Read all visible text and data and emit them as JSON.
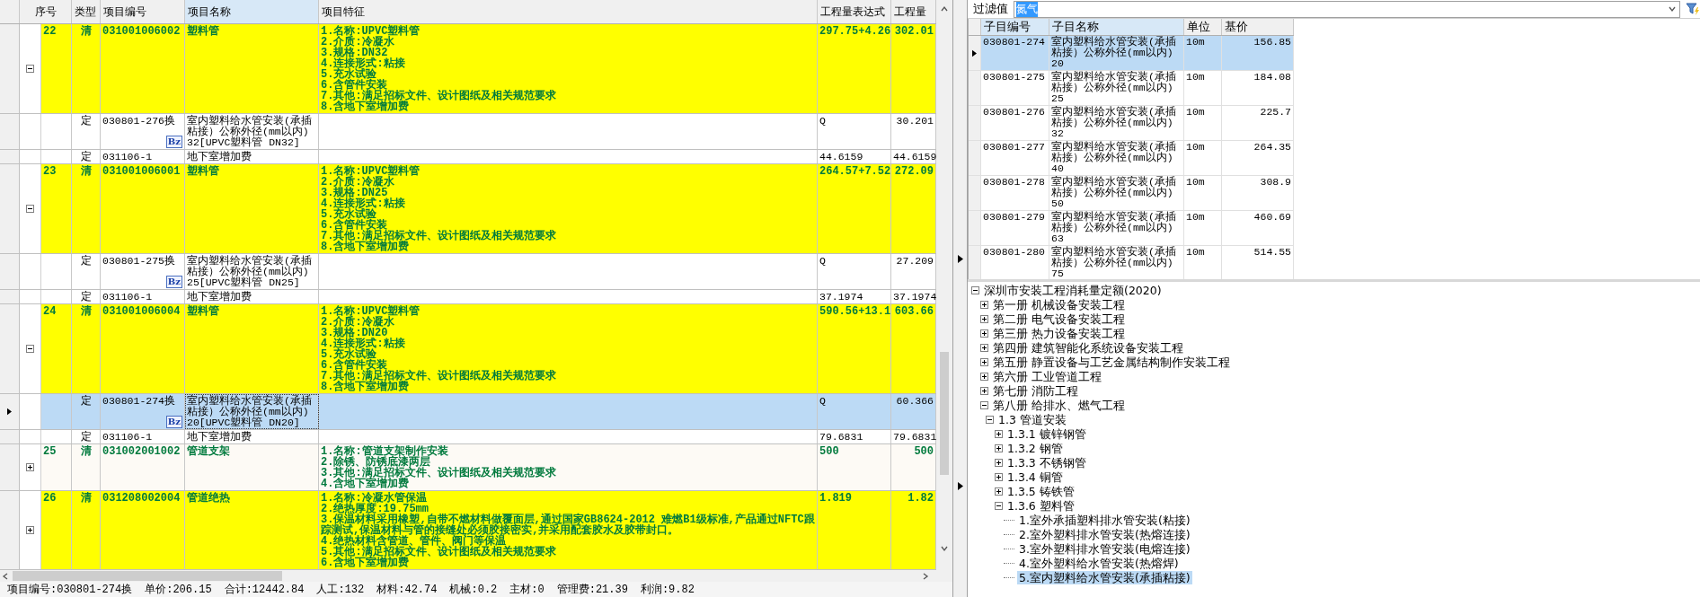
{
  "main_table": {
    "columns": [
      {
        "label": "序号",
        "selected": false
      },
      {
        "label": "类型",
        "selected": false
      },
      {
        "label": "项目编号",
        "selected": false
      },
      {
        "label": "项目名称",
        "selected": true
      },
      {
        "label": "项目特征",
        "selected": false
      },
      {
        "label": "工程量表达式",
        "selected": false
      },
      {
        "label": "工程量",
        "selected": false
      }
    ],
    "rows": [
      {
        "seq": "22",
        "type": "清",
        "code": "031001006002",
        "name": "塑料管",
        "features": [
          "1.名称:UPVC塑料管",
          "2.介质:冷凝水",
          "3.规格:DN32",
          "4.连接形式:粘接",
          "5.充水试验",
          "6.含管件安装",
          "7.其他:满足招标文件、设计图纸及相关规范要求",
          "8.含地下室增加费"
        ],
        "expr": "297.75+4.26",
        "qty": "302.01",
        "highlight": true,
        "expanded": true,
        "children": [
          {
            "type": "定",
            "code": "030801-276换",
            "badge": "Bz",
            "name": [
              "室内塑料给水管安装(承插",
              "粘接）公称外径(mm以内)",
              "32[UPVC塑料管 DN32]"
            ],
            "expr": "Q",
            "qty": "30.201",
            "selected": false
          },
          {
            "type": "定",
            "code": "031106-1",
            "name": [
              "地下室增加费"
            ],
            "expr": "44.6159",
            "qty": "44.6159",
            "selected": false
          }
        ]
      },
      {
        "seq": "23",
        "type": "清",
        "code": "031001006001",
        "name": "塑料管",
        "features": [
          "1.名称:UPVC塑料管",
          "2.介质:冷凝水",
          "3.规格:DN25",
          "4.连接形式:粘接",
          "5.充水试验",
          "6.含管件安装",
          "7.其他:满足招标文件、设计图纸及相关规范要求",
          "8.含地下室增加费"
        ],
        "expr": "264.57+7.52",
        "qty": "272.09",
        "highlight": true,
        "expanded": true,
        "children": [
          {
            "type": "定",
            "code": "030801-275换",
            "badge": "Bz",
            "name": [
              "室内塑料给水管安装(承插",
              "粘接）公称外径(mm以内)",
              "25[UPVC塑料管 DN25]"
            ],
            "expr": "Q",
            "qty": "27.209",
            "selected": false
          },
          {
            "type": "定",
            "code": "031106-1",
            "name": [
              "地下室增加费"
            ],
            "expr": "37.1974",
            "qty": "37.1974",
            "selected": false
          }
        ]
      },
      {
        "seq": "24",
        "type": "清",
        "code": "031001006004",
        "name": "塑料管",
        "features": [
          "1.名称:UPVC塑料管",
          "2.介质:冷凝水",
          "3.规格:DN20",
          "4.连接形式:粘接",
          "5.充水试验",
          "6.含管件安装",
          "7.其他:满足招标文件、设计图纸及相关规范要求",
          "8.含地下室增加费"
        ],
        "expr": "590.56+13.1",
        "qty": "603.66",
        "highlight": true,
        "expanded": true,
        "children": [
          {
            "type": "定",
            "code": "030801-274换",
            "badge": "Bz",
            "name": [
              "室内塑料给水管安装(承插",
              "粘接）公称外径(mm以内)",
              "20[UPVC塑料管 DN20]"
            ],
            "expr": "Q",
            "qty": "60.366",
            "selected": true
          },
          {
            "type": "定",
            "code": "031106-1",
            "name": [
              "地下室增加费"
            ],
            "expr": "79.6831",
            "qty": "79.6831",
            "selected": false
          }
        ]
      },
      {
        "seq": "25",
        "type": "清",
        "code": "031002001002",
        "name": "管道支架",
        "features": [
          "1.名称:管道支架制作安装",
          "2.除锈、防锈底漆两层",
          "3.其他:满足招标文件、设计图纸及相关规范要求",
          "4.含地下室增加费"
        ],
        "expr": "500",
        "qty": "500",
        "highlight": false,
        "expanded": false
      },
      {
        "seq": "26",
        "type": "清",
        "code": "031208002004",
        "name": "管道绝热",
        "features": [
          "1.名称:冷凝水管保温",
          "2.绝热厚度:19.75mm",
          "3.保温材料采用橡塑,自带不燃材料做覆面层,通过国家GB8624-2012 难燃B1级标准,产品通过NFTC跟踪测试,保温材料与管的接缝处必须胶接密实,并采用配套胶水及胶带封口。",
          "4.绝热材料含管道、管件、阀门等保温",
          "5.其他:满足招标文件、设计图纸及相关规范要求",
          "6.含地下室增加费"
        ],
        "expr": "1.819",
        "qty": "1.82",
        "highlight": true,
        "expanded": false
      }
    ]
  },
  "status_bar": [
    "项目编号:030801-274换",
    "单价:206.15",
    "合计:12442.84",
    "人工:132",
    "材料:42.74",
    "机械:0.2",
    "主材:0",
    "管理费:21.39",
    "利润:9.82"
  ],
  "filter": {
    "label": "过滤值",
    "value": "氮气"
  },
  "quota_table": {
    "columns": [
      "子目编号",
      "子目名称",
      "单位",
      "基价"
    ],
    "rows": [
      {
        "code": "030801-274",
        "name": [
          "室内塑料给水管安装(承插",
          "粘接）公称外径(mm以内)",
          "20"
        ],
        "unit": "10m",
        "price": "156.85",
        "selected": true
      },
      {
        "code": "030801-275",
        "name": [
          "室内塑料给水管安装(承插",
          "粘接）公称外径(mm以内)",
          "25"
        ],
        "unit": "10m",
        "price": "184.08",
        "selected": false
      },
      {
        "code": "030801-276",
        "name": [
          "室内塑料给水管安装(承插",
          "粘接）公称外径(mm以内)",
          "32"
        ],
        "unit": "10m",
        "price": "225.7",
        "selected": false
      },
      {
        "code": "030801-277",
        "name": [
          "室内塑料给水管安装(承插",
          "粘接）公称外径(mm以内)",
          "40"
        ],
        "unit": "10m",
        "price": "264.35",
        "selected": false
      },
      {
        "code": "030801-278",
        "name": [
          "室内塑料给水管安装(承插",
          "粘接）公称外径(mm以内)",
          "50"
        ],
        "unit": "10m",
        "price": "308.9",
        "selected": false
      },
      {
        "code": "030801-279",
        "name": [
          "室内塑料给水管安装(承插",
          "粘接）公称外径(mm以内)",
          "63"
        ],
        "unit": "10m",
        "price": "460.69",
        "selected": false
      },
      {
        "code": "030801-280",
        "name": [
          "室内塑料给水管安装(承插",
          "粘接）公称外径(mm以内)",
          "75"
        ],
        "unit": "10m",
        "price": "514.55",
        "selected": false
      }
    ]
  },
  "tree": {
    "label": "深圳市安装工程消耗量定额(2020)",
    "expanded": true,
    "selected": false,
    "children": [
      {
        "label": "第一册 机械设备安装工程",
        "expanded": false,
        "selected": false
      },
      {
        "label": "第二册 电气设备安装工程",
        "expanded": false,
        "selected": false
      },
      {
        "label": "第三册 热力设备安装工程",
        "expanded": false,
        "selected": false
      },
      {
        "label": "第四册 建筑智能化系统设备安装工程",
        "expanded": false,
        "selected": false
      },
      {
        "label": "第五册 静置设备与工艺金属结构制作安装工程",
        "expanded": false,
        "selected": false
      },
      {
        "label": "第六册 工业管道工程",
        "expanded": false,
        "selected": false
      },
      {
        "label": "第七册 消防工程",
        "expanded": false,
        "selected": false
      },
      {
        "label": "第八册 给排水、燃气工程",
        "expanded": true,
        "selected": false,
        "children": [
          {
            "label": "1.3 管道安装",
            "expanded": true,
            "selected": false,
            "children": [
              {
                "label": "1.3.1 镀锌钢管",
                "expanded": false,
                "selected": false
              },
              {
                "label": "1.3.2 钢管",
                "expanded": false,
                "selected": false
              },
              {
                "label": "1.3.3 不锈钢管",
                "expanded": false,
                "selected": false
              },
              {
                "label": "1.3.4 铜管",
                "expanded": false,
                "selected": false
              },
              {
                "label": "1.3.5 铸铁管",
                "expanded": false,
                "selected": false
              },
              {
                "label": "1.3.6 塑料管",
                "expanded": true,
                "selected": false,
                "children": [
                  {
                    "label": "1.室外承插塑料排水管安装(粘接)",
                    "selected": false
                  },
                  {
                    "label": "2.室外塑料排水管安装(热熔连接)",
                    "selected": false
                  },
                  {
                    "label": "3.室外塑料排水管安装(电熔连接)",
                    "selected": false
                  },
                  {
                    "label": "4.室外塑料给水管安装(热熔焊)",
                    "selected": false
                  },
                  {
                    "label": "5.室内塑料给水管安装(承插粘接)",
                    "selected": true
                  }
                ]
              }
            ]
          }
        ]
      }
    ]
  }
}
